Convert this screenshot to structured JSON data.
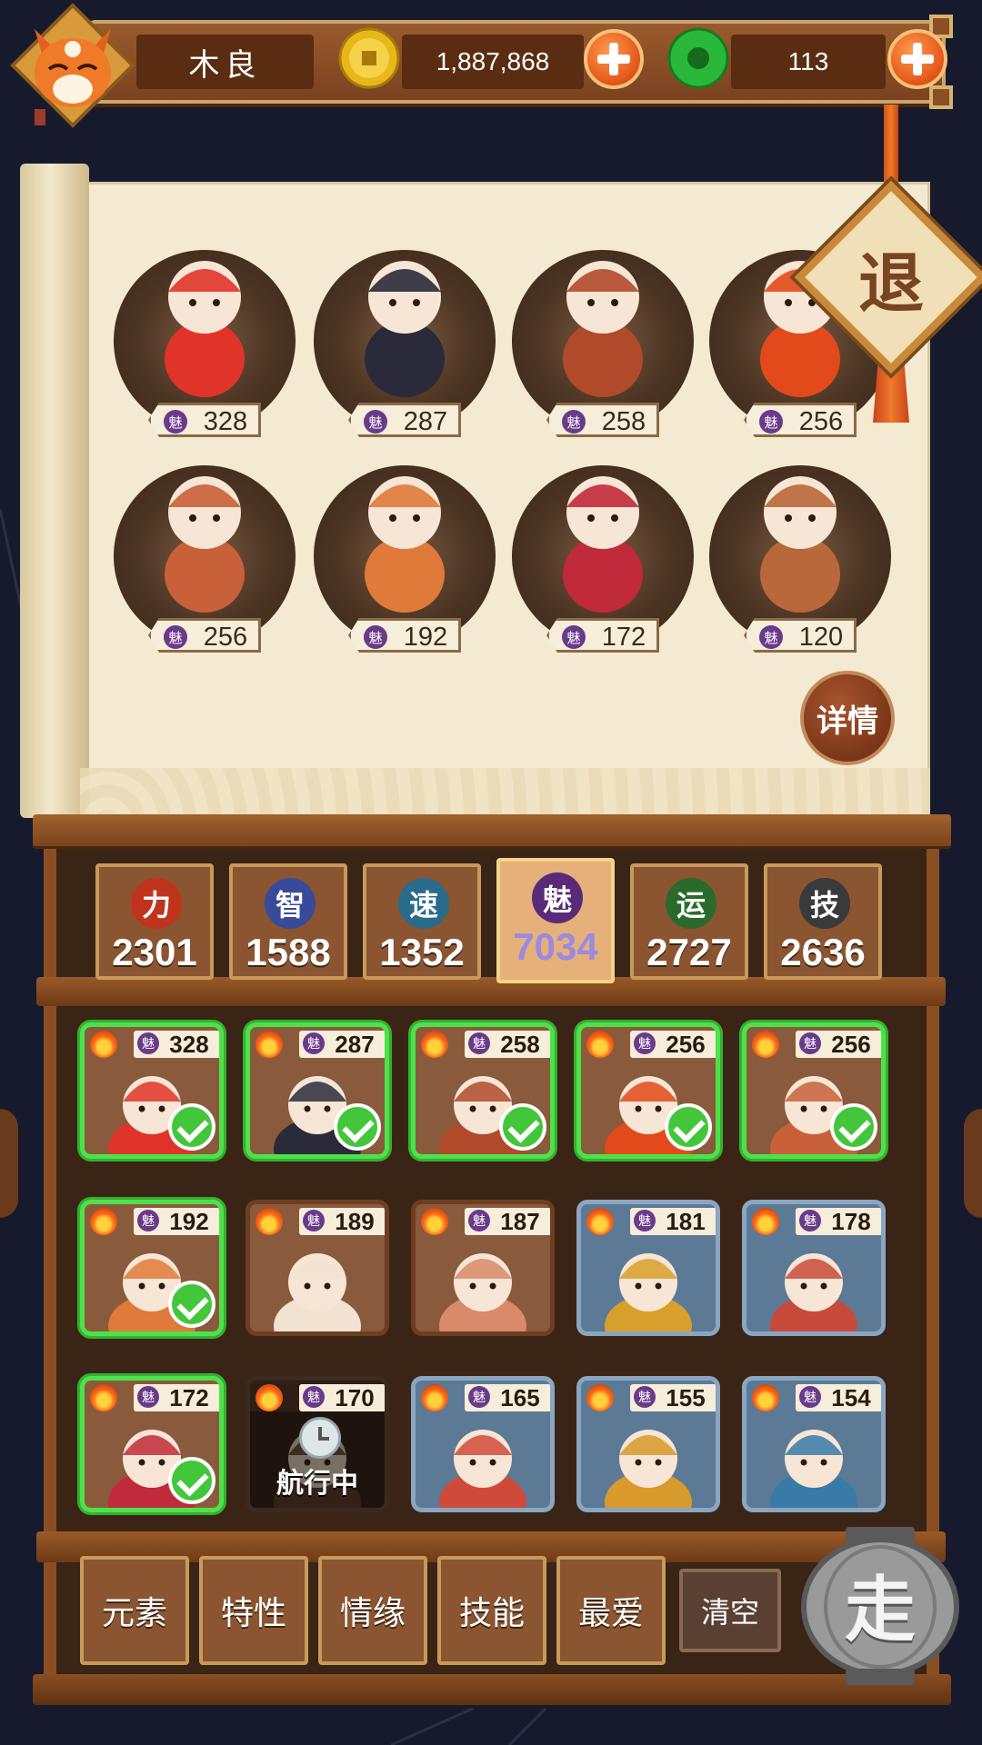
{
  "header": {
    "player_name": "木良",
    "gold": "1,887,868",
    "jade": "113"
  },
  "scroll": {
    "characters": [
      {
        "charm": "魅",
        "value": "328"
      },
      {
        "charm": "魅",
        "value": "287"
      },
      {
        "charm": "魅",
        "value": "258"
      },
      {
        "charm": "魅",
        "value": "256"
      },
      {
        "charm": "魅",
        "value": "256"
      },
      {
        "charm": "魅",
        "value": "192"
      },
      {
        "charm": "魅",
        "value": "172"
      },
      {
        "charm": "魅",
        "value": "120"
      }
    ],
    "detail_label": "详情",
    "exit_label": "退"
  },
  "attributes": [
    {
      "icon": "力",
      "value": "2301",
      "color": "#c0341e"
    },
    {
      "icon": "智",
      "value": "1588",
      "color": "#3a4a9a"
    },
    {
      "icon": "速",
      "value": "1352",
      "color": "#2a6a8a"
    },
    {
      "icon": "魅",
      "value": "7034",
      "color": "#5a2a7a",
      "active": true
    },
    {
      "icon": "运",
      "value": "2727",
      "color": "#2a6a2a"
    },
    {
      "icon": "技",
      "value": "2636",
      "color": "#3a3a3a"
    }
  ],
  "roster": [
    {
      "charm": "魅",
      "value": "328",
      "selected": true
    },
    {
      "charm": "魅",
      "value": "287",
      "selected": true
    },
    {
      "charm": "魅",
      "value": "258",
      "selected": true
    },
    {
      "charm": "魅",
      "value": "256",
      "selected": true
    },
    {
      "charm": "魅",
      "value": "256",
      "selected": true
    },
    {
      "charm": "魅",
      "value": "192",
      "selected": true
    },
    {
      "charm": "魅",
      "value": "189",
      "selected": false
    },
    {
      "charm": "魅",
      "value": "187",
      "selected": false
    },
    {
      "charm": "魅",
      "value": "181",
      "selected": false
    },
    {
      "charm": "魅",
      "value": "178",
      "selected": false
    },
    {
      "charm": "魅",
      "value": "172",
      "selected": true
    },
    {
      "charm": "魅",
      "value": "170",
      "selected": false,
      "status": "航行中"
    },
    {
      "charm": "魅",
      "value": "165",
      "selected": false
    },
    {
      "charm": "魅",
      "value": "155",
      "selected": false
    },
    {
      "charm": "魅",
      "value": "154",
      "selected": false
    }
  ],
  "filters": [
    "元素",
    "特性",
    "情缘",
    "技能",
    "最爱"
  ],
  "clear_label": "清空",
  "go_label": "走"
}
